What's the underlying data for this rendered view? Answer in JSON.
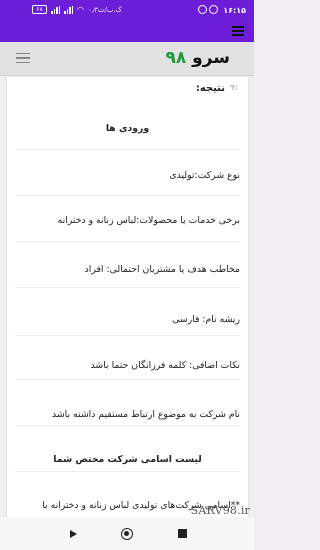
{
  "status_bar": {
    "time": "۱۶:۱۵",
    "network_text": "۰٫۳ک.ب/ث",
    "battery": "۶۸"
  },
  "site": {
    "logo_word": "سرو",
    "logo_number": "۹۸"
  },
  "result": {
    "title": "نتیجه:",
    "inputs_heading": "ورودی ها",
    "company_type": "نوع شرکت:تولیدی",
    "services": "برخی خدمات یا محصولات:لباس زنانه و دخترانه",
    "audience": "مخاطب هدف یا مشتریان احتمالی: افراد",
    "name_root": "ریشه نام: فارسی",
    "extra_notes": "نکات اضافی: کلمه فرزانگان حتما باشد",
    "relation_note": "نام شرکت به موضوع ارتباط مستقیم داشته باشد",
    "list_heading": "لیست اسامی شرکت مختص شما",
    "list_item_1": "**اسامی شرکت‌های تولیدی لباس زنانه و دخترانه با"
  },
  "watermark": "SARV98.ir",
  "icons": {
    "menu": "hamburger-icon",
    "hand": "pointing-hand-icon",
    "nav_back": "back-triangle-icon",
    "nav_home": "home-circle-icon",
    "nav_recent": "recent-square-icon"
  },
  "colors": {
    "toolbar": "#6b1ed6",
    "logo_number": "#1f9a3a"
  }
}
